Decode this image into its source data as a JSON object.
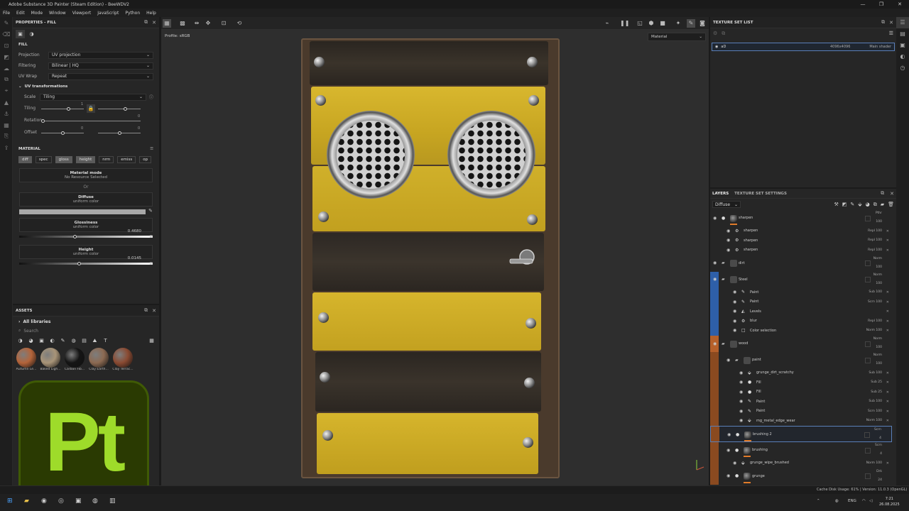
{
  "window": {
    "title": "Adobe Substance 3D Painter (Steam Edition) - BeeWDV2",
    "controls": [
      "—",
      "❐",
      "✕"
    ]
  },
  "menu": [
    "File",
    "Edit",
    "Mode",
    "Window",
    "Viewport",
    "JavaScript",
    "Python",
    "Help"
  ],
  "properties": {
    "panel_title": "PROPERTIES - FILL",
    "section_fill": "FILL",
    "projection_label": "Projection",
    "projection_value": "UV projection",
    "filtering_label": "Filtering",
    "filtering_value": "Bilinear | HQ",
    "uvwrap_label": "UV Wrap",
    "uvwrap_value": "Repeat",
    "uv_transforms_label": "UV transformations",
    "scale_label": "Scale",
    "scale_value": "Tiling",
    "tiling_label": "Tiling",
    "tiling_value": "1",
    "rotation_label": "Rotation",
    "rotation_value": "0",
    "offset_label": "Offset",
    "offset_value_1": "0",
    "offset_value_2": "0",
    "section_material": "MATERIAL",
    "channels": [
      "diff",
      "spec",
      "gloss",
      "height",
      "nrm",
      "emiss",
      "op"
    ],
    "material_mode_title": "Material mode",
    "material_mode_sub": "No Resource Selected",
    "or_label": "Or",
    "diffuse_title": "Diffuse",
    "diffuse_sub": "uniform color",
    "diffuse_color": "#a8a8a8",
    "glossiness_title": "Glossiness",
    "glossiness_sub": "uniform color",
    "glossiness_value": "0.4680",
    "height_title": "Height",
    "height_sub": "uniform color",
    "height_value": "0.0145"
  },
  "assets": {
    "panel_title": "ASSETS",
    "all_libraries": "All libraries",
    "search_placeholder": "Search",
    "materials": [
      {
        "name": "Autumn Le...",
        "color": "#b4643a"
      },
      {
        "name": "Baked Ligh...",
        "color": "#a89478"
      },
      {
        "name": "Carbon Fib...",
        "color": "#141414"
      },
      {
        "name": "Clay Earth...",
        "color": "#8c6a52"
      },
      {
        "name": "Clay Terrac...",
        "color": "#8a4a32"
      }
    ]
  },
  "logo_text": "Pt",
  "viewport": {
    "profile_text": "Profile: sRGB",
    "material_select": "Material"
  },
  "texture_set_list": {
    "panel_title": "TEXTURE SET LIST",
    "set_name": "aD",
    "set_resolution": "4096x4096",
    "set_shader": "Main shader"
  },
  "layers": {
    "tab_layers": "LAYERS",
    "tab_settings": "TEXTURE SET SETTINGS",
    "channel": "Diffuse",
    "rows": [
      {
        "name": "sharpen",
        "blend": "Pthr",
        "opacity": "100",
        "indent": 0,
        "kind": "fill",
        "group_color": ""
      },
      {
        "name": "sharpen",
        "blend": "Repl",
        "opacity": "100",
        "indent": 1,
        "kind": "filter",
        "group_color": ""
      },
      {
        "name": "sharpen",
        "blend": "Repl",
        "opacity": "100",
        "indent": 1,
        "kind": "filter",
        "group_color": ""
      },
      {
        "name": "sharpen",
        "blend": "Repl",
        "opacity": "100",
        "indent": 1,
        "kind": "filter",
        "group_color": ""
      },
      {
        "name": "dirt",
        "blend": "Norm",
        "opacity": "100",
        "indent": 0,
        "kind": "folder",
        "group_color": ""
      },
      {
        "name": "Steel",
        "blend": "Norm",
        "opacity": "100",
        "indent": 0,
        "kind": "folder",
        "group_color": "#2e5fa8"
      },
      {
        "name": "Paint",
        "blend": "Sub",
        "opacity": "100",
        "indent": 2,
        "kind": "paint",
        "group_color": "#2e5fa8"
      },
      {
        "name": "Paint",
        "blend": "Scrn",
        "opacity": "100",
        "indent": 2,
        "kind": "paint",
        "group_color": "#2e5fa8"
      },
      {
        "name": "Levels",
        "blend": "",
        "opacity": "",
        "indent": 2,
        "kind": "levels",
        "group_color": "#2e5fa8"
      },
      {
        "name": "blur",
        "blend": "Repl",
        "opacity": "100",
        "indent": 2,
        "kind": "filter",
        "group_color": "#2e5fa8"
      },
      {
        "name": "Color selection",
        "blend": "Norm",
        "opacity": "100",
        "indent": 2,
        "kind": "mask",
        "group_color": "#2e5fa8"
      },
      {
        "name": "wood",
        "blend": "Norm",
        "opacity": "100",
        "indent": 0,
        "kind": "folder",
        "group_color": "#b5602a"
      },
      {
        "name": "paint",
        "blend": "Norm",
        "opacity": "100",
        "indent": 1,
        "kind": "folder",
        "group_color": "#8a4a20"
      },
      {
        "name": "grunge_dirt_scratchy",
        "blend": "Sub",
        "opacity": "100",
        "indent": 3,
        "kind": "generator",
        "group_color": "#8a4a20"
      },
      {
        "name": "Fill",
        "blend": "Sub",
        "opacity": "25",
        "indent": 3,
        "kind": "fill",
        "group_color": "#8a4a20"
      },
      {
        "name": "Fill",
        "blend": "Sub",
        "opacity": "25",
        "indent": 3,
        "kind": "fill",
        "group_color": "#8a4a20"
      },
      {
        "name": "Paint",
        "blend": "Sub",
        "opacity": "100",
        "indent": 3,
        "kind": "paint",
        "group_color": "#8a4a20"
      },
      {
        "name": "Paint",
        "blend": "Scrn",
        "opacity": "100",
        "indent": 3,
        "kind": "paint",
        "group_color": "#8a4a20"
      },
      {
        "name": "mg_metal_edge_wear",
        "blend": "Norm",
        "opacity": "100",
        "indent": 3,
        "kind": "generator",
        "group_color": "#8a4a20"
      },
      {
        "name": "brushing 2",
        "blend": "Scrn",
        "opacity": "4",
        "indent": 1,
        "kind": "layer",
        "group_color": "#8a4a20"
      },
      {
        "name": "brushing",
        "blend": "Scrn",
        "opacity": "4",
        "indent": 1,
        "kind": "layer",
        "group_color": "#8a4a20"
      },
      {
        "name": "grunge_wipe_brushed",
        "blend": "Norm",
        "opacity": "100",
        "indent": 2,
        "kind": "generator",
        "group_color": "#8a4a20"
      },
      {
        "name": "grunge",
        "blend": "Drk",
        "opacity": "24",
        "indent": 1,
        "kind": "layer",
        "group_color": "#8a4a20"
      }
    ]
  },
  "status": {
    "text": "Cache Disk Usage:   61% | Version: 11.0.3 (OpenGL)"
  },
  "taskbar": {
    "lang": "ENG",
    "time": "7:21",
    "date": "26.08.2025"
  }
}
